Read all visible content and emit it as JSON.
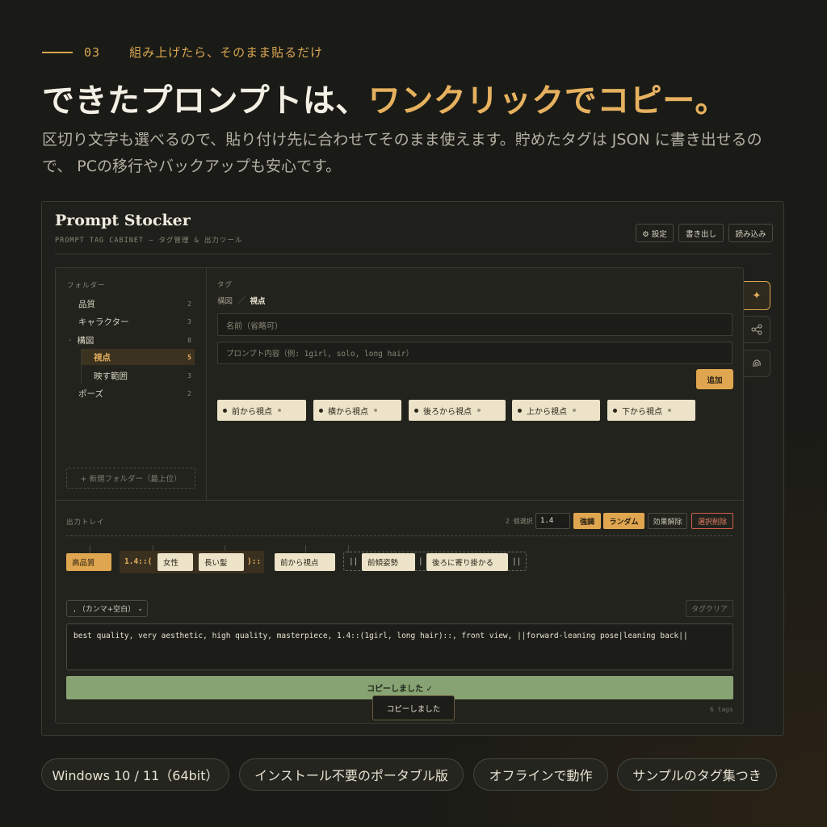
{
  "section": {
    "number": "03",
    "label": "組み上げたら、そのまま貼るだけ"
  },
  "headline": {
    "main": "できたプロンプトは、",
    "accent": "ワンクリックでコピー。"
  },
  "description": "区切り文字も選べるので、貼り付け先に合わせてそのまま使えます。貯めたタグは JSON に書き出せるので、 PCの移行やバックアップも安心です。",
  "app": {
    "title": "Prompt Stocker",
    "subtitle": "PROMPT TAG CABINET — タグ管理 & 出力ツール",
    "header_buttons": {
      "settings": "⚙ 設定",
      "export": "書き出し",
      "import": "読み込み"
    },
    "folders": {
      "label": "フォルダー",
      "items": [
        {
          "label": "品質",
          "count": "2"
        },
        {
          "label": "キャラクター",
          "count": "3"
        },
        {
          "label": "構図",
          "count": "8",
          "marker": "·"
        },
        {
          "label": "視点",
          "count": "5"
        },
        {
          "label": "映す範囲",
          "count": "3"
        },
        {
          "label": "ポーズ",
          "count": "2"
        }
      ],
      "new_folder": "+ 新規フォルダー（最上位）"
    },
    "tags": {
      "label": "タグ",
      "breadcrumb_parent": "構図",
      "breadcrumb_sep": "／",
      "breadcrumb_current": "視点",
      "name_placeholder": "名前（省略可）",
      "content_placeholder": "プロンプト内容（例: 1girl, solo, long hair）",
      "add_button": "追加",
      "items": [
        "前から視点",
        "横から視点",
        "後ろから視点",
        "上から視点",
        "下から視点"
      ]
    },
    "side_icons": [
      "sparkle-icon",
      "share-icon",
      "fingerprint-icon"
    ],
    "tray": {
      "label": "出力トレイ",
      "selected_count": "2 個選択",
      "weight_value": "1.4",
      "buttons": {
        "emphasis": "強調",
        "random": "ランダム",
        "remove_effect": "効果解除",
        "delete_selected": "選択削除"
      },
      "chips": {
        "quality": "高品質",
        "weight_open": "1.4::(",
        "female": "女性",
        "long_hair": "長い髪",
        "weight_close": "):: ",
        "front_view": "前から視点",
        "alt_open": "||",
        "lean_forward": "前傾姿勢",
        "alt_sep": "|",
        "lean_back": "後ろに寄り掛かる",
        "alt_close": "||"
      }
    },
    "separator_select": ", （カンマ+空白）",
    "clear_button": "タグクリア",
    "output_text": "best quality, very aesthetic, high quality, masterpiece, 1.4::(1girl, long hair)::, front view, ||forward-leaning pose|leaning back||",
    "copy_button": "コピーしました ✓",
    "toast": "コピーしました",
    "tag_count": "6 tags"
  },
  "features": [
    "Windows 10 / 11（64bit）",
    "インストール不要のポータブル版",
    "オフラインで動作",
    "サンプルのタグ集つき"
  ],
  "colors": {
    "accent": "#e6b15f",
    "background": "#1a1b16",
    "copy_green": "#87a373",
    "danger": "#d0604a"
  }
}
